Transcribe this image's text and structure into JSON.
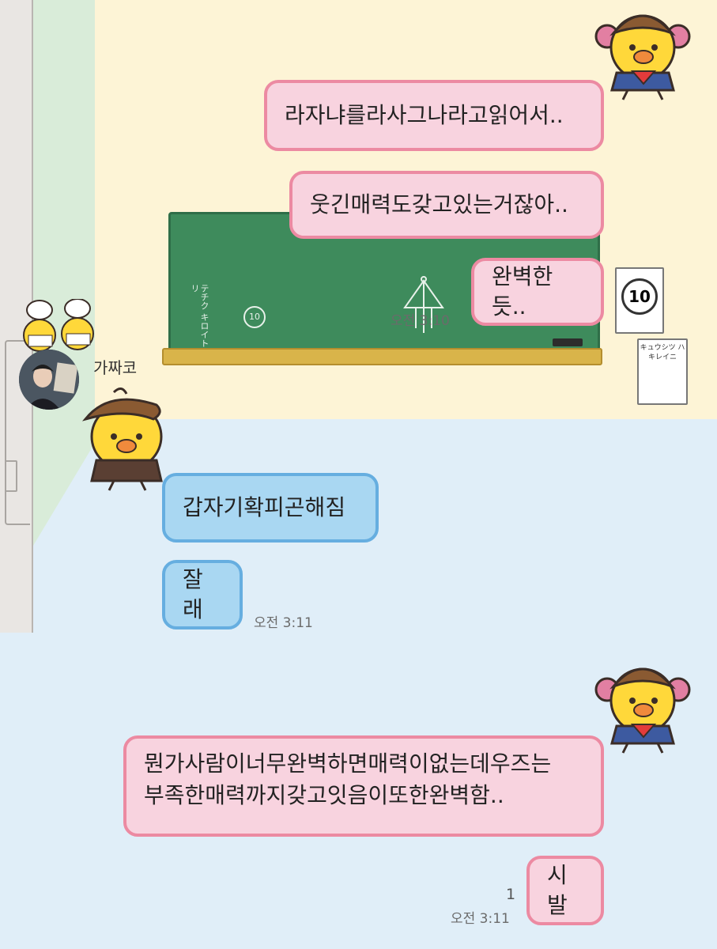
{
  "chat": {
    "sender_name": "가짜코",
    "messages": [
      {
        "side": "me",
        "text": "라자냐를라사그나라고읽어서.."
      },
      {
        "side": "me",
        "text": "웃긴매력도갖고있는거잖아.."
      },
      {
        "side": "me",
        "text": "완벽한듯.."
      },
      {
        "side": "them",
        "text": "갑자기확피곤해짐"
      },
      {
        "side": "them",
        "text": "잘래"
      },
      {
        "side": "me",
        "line1": "뭔가사람이너무완벽하면매력이없는데우즈는",
        "line2": "부족한매력까지갖고잇음이또한완벽함.."
      },
      {
        "side": "me",
        "text": "시발"
      }
    ],
    "timestamps": {
      "t1": "오전 3:10",
      "t2": "오전 3:11",
      "t3": "오전 3:11"
    },
    "unread_count": "1"
  },
  "background": {
    "chalk_text_1": "テチク キロイトリ",
    "chalk_text_2": "10",
    "poster_1": "10",
    "poster_2": "キュウシツ ハ キレイニ"
  },
  "colors": {
    "me_bubble": "#f8d3df",
    "me_border": "#ec8aa2",
    "them_bubble": "#a9d7f2",
    "them_border": "#66aee0",
    "wall_upper": "#fdf4d6",
    "floor": "#e0eef8",
    "blackboard": "#3e8b5c"
  },
  "icons": [
    "chick-girl-icon",
    "chick-boy-icon",
    "chick-chef-icon",
    "profile-avatar"
  ]
}
